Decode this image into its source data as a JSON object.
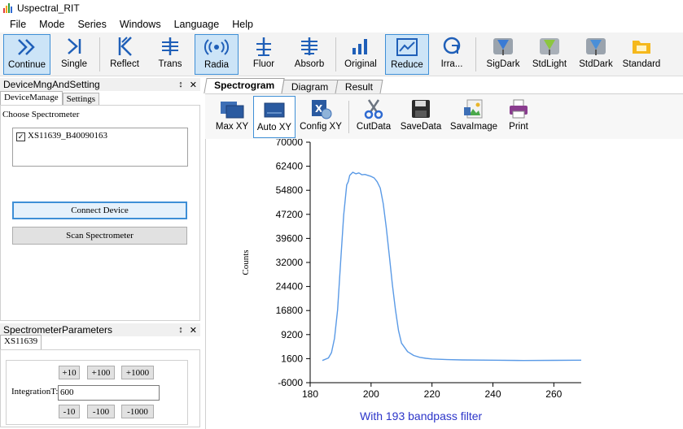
{
  "window": {
    "title": "Uspectral_RIT"
  },
  "menu": [
    "File",
    "Mode",
    "Series",
    "Windows",
    "Language",
    "Help"
  ],
  "toolbar": [
    {
      "label": "Continue",
      "icon": "continue-icon",
      "active": true
    },
    {
      "label": "Single",
      "icon": "single-icon",
      "active": false
    },
    {
      "label": "Reflect",
      "icon": "reflect-icon",
      "active": false
    },
    {
      "label": "Trans",
      "icon": "trans-icon",
      "active": false
    },
    {
      "label": "Radia",
      "icon": "radia-icon",
      "active": true
    },
    {
      "label": "Fluor",
      "icon": "fluor-icon",
      "active": false
    },
    {
      "label": "Absorb",
      "icon": "absorb-icon",
      "active": false
    },
    {
      "label": "Original",
      "icon": "original-icon",
      "active": false
    },
    {
      "label": "Reduce",
      "icon": "reduce-icon",
      "active": true
    },
    {
      "label": "Irra...",
      "icon": "irradiance-icon",
      "active": false
    },
    {
      "label": "SigDark",
      "icon": "sigdark-icon",
      "active": false
    },
    {
      "label": "StdLight",
      "icon": "stdlight-icon",
      "active": false
    },
    {
      "label": "StdDark",
      "icon": "stddark-icon",
      "active": false
    },
    {
      "label": "Standard",
      "icon": "standard-folder-icon",
      "active": false
    }
  ],
  "device_panel": {
    "title": "DeviceMngAndSetting",
    "pin": "↕",
    "close": "✕",
    "tabs": [
      "DeviceManage",
      "Settings"
    ],
    "group_label": "Choose Spectrometer",
    "device_item": "XS11639_B40090163",
    "device_checked": true,
    "connect_label": "Connect Device",
    "scan_label": "Scan Spectrometer"
  },
  "params_panel": {
    "title": "SpectrometerParameters",
    "pin": "↕",
    "close": "✕",
    "tab": "XS11639",
    "plus_buttons": [
      "+10",
      "+100",
      "+1000"
    ],
    "minus_buttons": [
      "-10",
      "-100",
      "-1000"
    ],
    "integration_label": "IntegrationT:",
    "integration_value": "600"
  },
  "main_tabs": [
    {
      "label": "Spectrogram",
      "selected": true
    },
    {
      "label": "Diagram",
      "selected": false
    },
    {
      "label": "Result",
      "selected": false
    }
  ],
  "sub_toolbar": [
    {
      "label": "Max XY",
      "icon": "max-xy-icon",
      "active": false
    },
    {
      "label": "Auto XY",
      "icon": "auto-xy-icon",
      "active": true
    },
    {
      "label": "Config XY",
      "icon": "config-xy-icon",
      "active": false
    },
    {
      "label": "CutData",
      "icon": "scissors-icon",
      "active": false
    },
    {
      "label": "SaveData",
      "icon": "floppy-disk-icon",
      "active": false
    },
    {
      "label": "SavaImage",
      "icon": "save-image-icon",
      "active": false
    },
    {
      "label": "Print",
      "icon": "printer-icon",
      "active": false
    }
  ],
  "chart_data": {
    "type": "line",
    "ylabel": "Counts",
    "xlabel": "",
    "xlim": [
      180,
      269
    ],
    "ylim": [
      -6000,
      70000
    ],
    "x_ticks": [
      180,
      200,
      220,
      240,
      260
    ],
    "y_ticks": [
      -6000,
      1600,
      9200,
      16800,
      24400,
      32000,
      39600,
      47200,
      54800,
      62400,
      70000
    ],
    "grid": false,
    "line_color": "#5a9ae6",
    "series": [
      {
        "x": [
          184,
          186,
          187,
          188,
          189,
          190,
          191,
          192,
          192.5,
          193,
          194,
          195,
          196,
          197,
          198,
          199,
          200,
          201,
          202,
          203,
          204,
          205,
          206,
          207,
          208,
          209,
          210,
          212,
          214,
          216,
          218,
          220,
          225,
          230,
          240,
          250,
          260,
          269
        ],
        "y": [
          1000,
          1800,
          3500,
          8000,
          17000,
          32000,
          47000,
          56500,
          57500,
          59500,
          60500,
          60000,
          60300,
          59700,
          59800,
          59500,
          59200,
          58700,
          57500,
          55500,
          50500,
          43000,
          34000,
          25000,
          17000,
          10500,
          6500,
          3800,
          2600,
          2000,
          1700,
          1500,
          1300,
          1200,
          1100,
          1000,
          1050,
          1100
        ]
      }
    ]
  },
  "caption": "With 193 bandpass filter"
}
